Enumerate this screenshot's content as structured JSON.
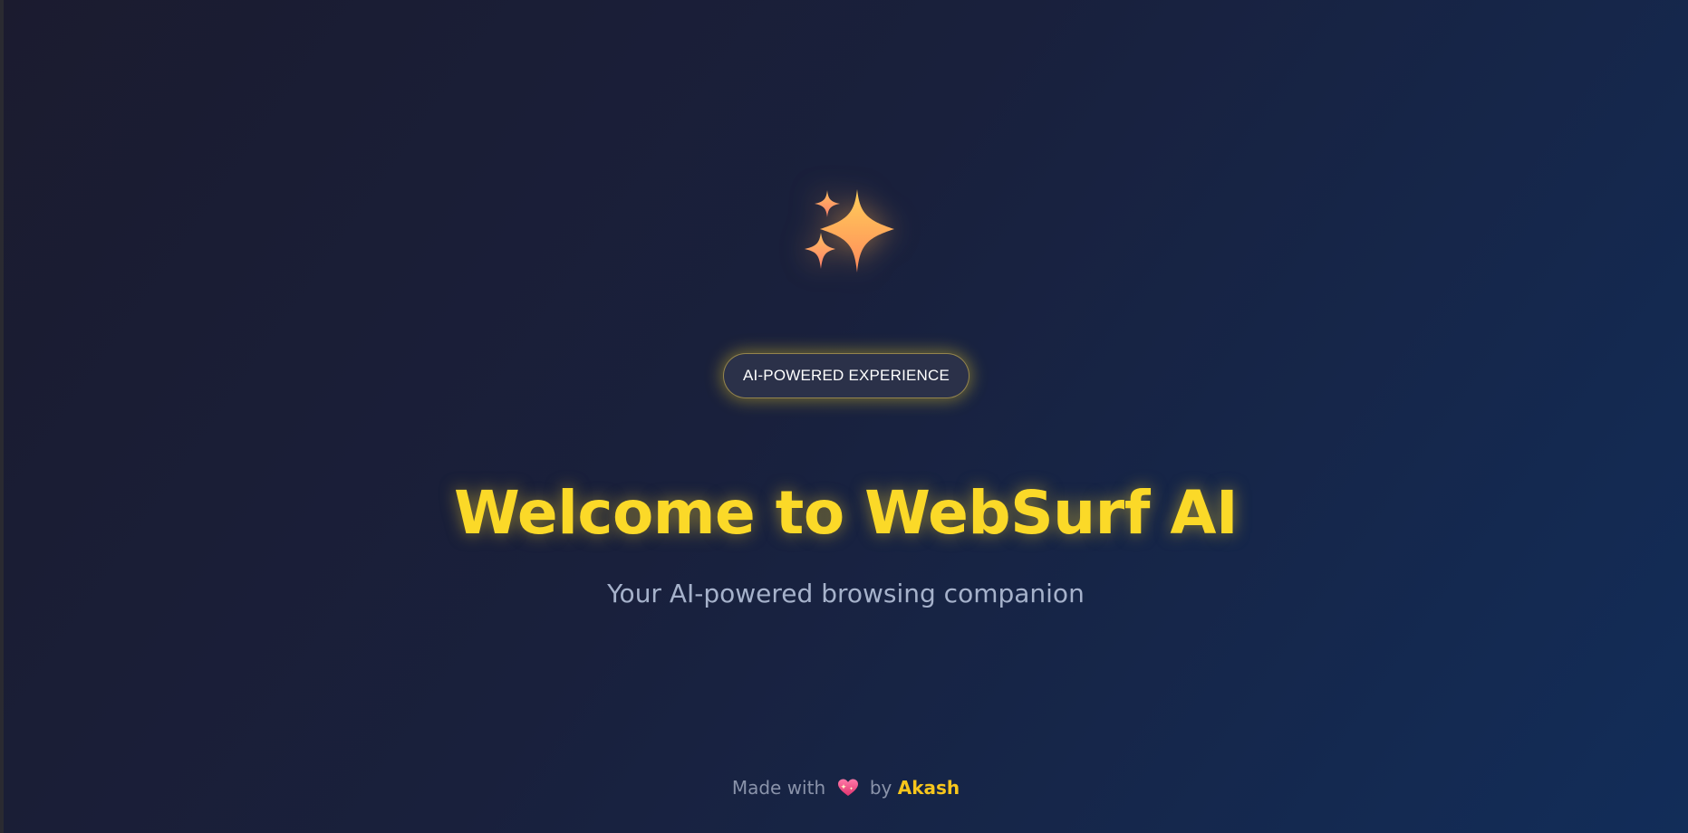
{
  "hero": {
    "icon": "sparkles-icon",
    "badge_label": "AI-POWERED EXPERIENCE",
    "title": "Welcome to WebSurf AI",
    "subtitle": "Your AI-powered browsing companion"
  },
  "footer": {
    "made_with": "Made with",
    "heart_icon": "sparkling-heart-icon",
    "by": "by",
    "author": "Akash"
  },
  "colors": {
    "accent_yellow": "#fbd928",
    "author_color": "#f7c61c",
    "badge_bg": "#2b3149",
    "subtitle_color": "#a6b2cb",
    "footer_text": "#8a93aa",
    "bg_start": "#1b1b2f",
    "bg_end": "#122d59"
  }
}
